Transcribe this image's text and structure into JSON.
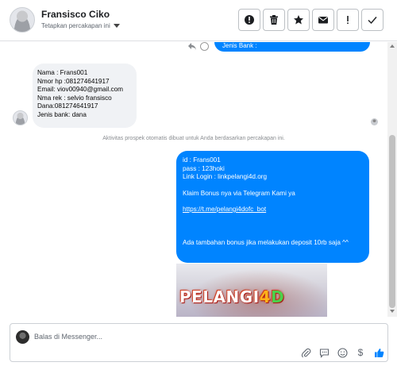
{
  "header": {
    "contact_name": "Fransisco Ciko",
    "assign_label": "Tetapkan percakapan ini",
    "toolbar": [
      {
        "icon": "alert-circle-icon",
        "label": "Mark as spam"
      },
      {
        "icon": "trash-icon",
        "label": "Delete"
      },
      {
        "icon": "star-icon",
        "label": "Star"
      },
      {
        "icon": "envelope-icon",
        "label": "Mark unread"
      },
      {
        "icon": "exclamation-icon",
        "label": "Follow up"
      },
      {
        "icon": "check-icon",
        "label": "Done"
      }
    ]
  },
  "messages": {
    "top_partial": "Jenis Bank :",
    "incoming": [
      "Nama : Frans001",
      "Nmor hp :081274641917",
      "Email: viov00940@gmail.com",
      "Nma rek : selvio fransisco",
      "Dana:081274641917",
      "Jenis bank: dana"
    ],
    "system_note": "Aktivitas prospek otomatis dibuat untuk Anda berdasarkan percakapan ini.",
    "outgoing": {
      "line1": "id : Frans001",
      "line2": "pass : 123hoki",
      "line3": "Link Login : linkpelangi4d.org",
      "line4": "Klaim Bonus nya via Telegram Kami ya",
      "line5": "https://t.me/pelangi4dofc_bot",
      "line6": "Ada tambahan bonus jika melakukan deposit 10rb saja ^^"
    },
    "image_text_part1": "PELANGI",
    "image_text_part2": "4",
    "image_text_part3": "D"
  },
  "composer": {
    "placeholder": "Balas di Messenger...",
    "value": "",
    "icons": [
      "paperclip-icon",
      "quick-reply-icon",
      "emoji-icon",
      "dollar-icon",
      "thumbs-up-icon"
    ],
    "dollar_glyph": "$"
  },
  "colors": {
    "accent": "#0084ff",
    "bubble_in": "#f0f2f5",
    "border": "#ccd0d5"
  }
}
